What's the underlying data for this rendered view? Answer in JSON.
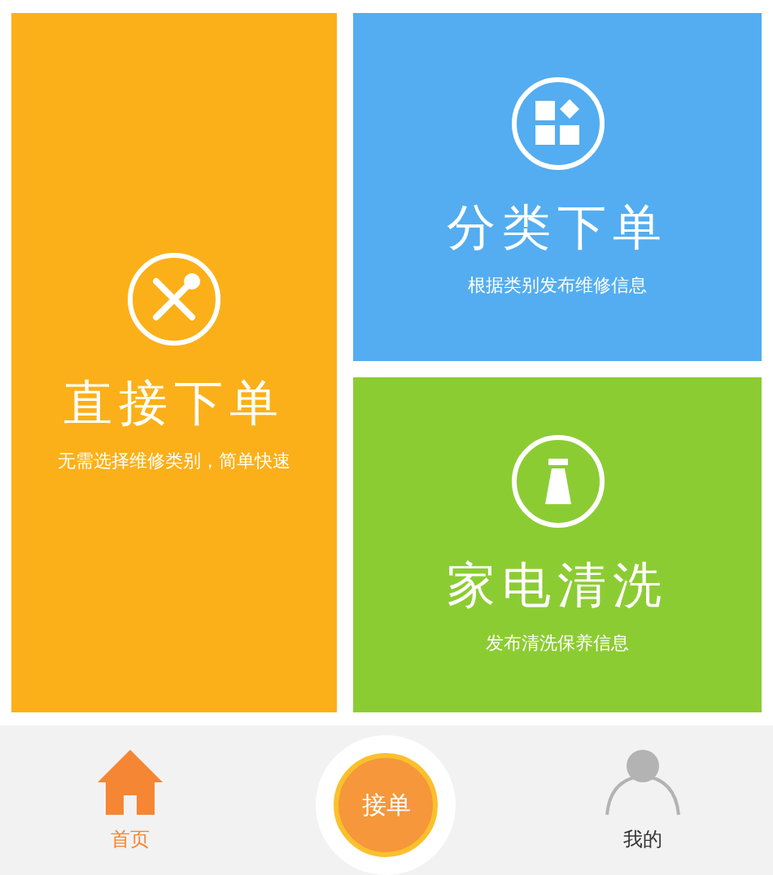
{
  "tiles": [
    {
      "kind": "repair",
      "title": "直接下单",
      "subtitle": "无需选择维修类别，简单快速",
      "color": "#fbb019"
    },
    {
      "kind": "category",
      "title": "分类下单",
      "subtitle": "根据类别发布维修信息",
      "color": "#53adf0"
    },
    {
      "kind": "clean",
      "title": "家电清洗",
      "subtitle": "发布清洗保养信息",
      "color": "#8ccc33"
    }
  ],
  "nav": [
    {
      "kind": "home",
      "label": "首页",
      "selected": true
    },
    {
      "kind": "center",
      "label": "接单"
    },
    {
      "kind": "profile",
      "label": "我的",
      "selected": false
    }
  ]
}
